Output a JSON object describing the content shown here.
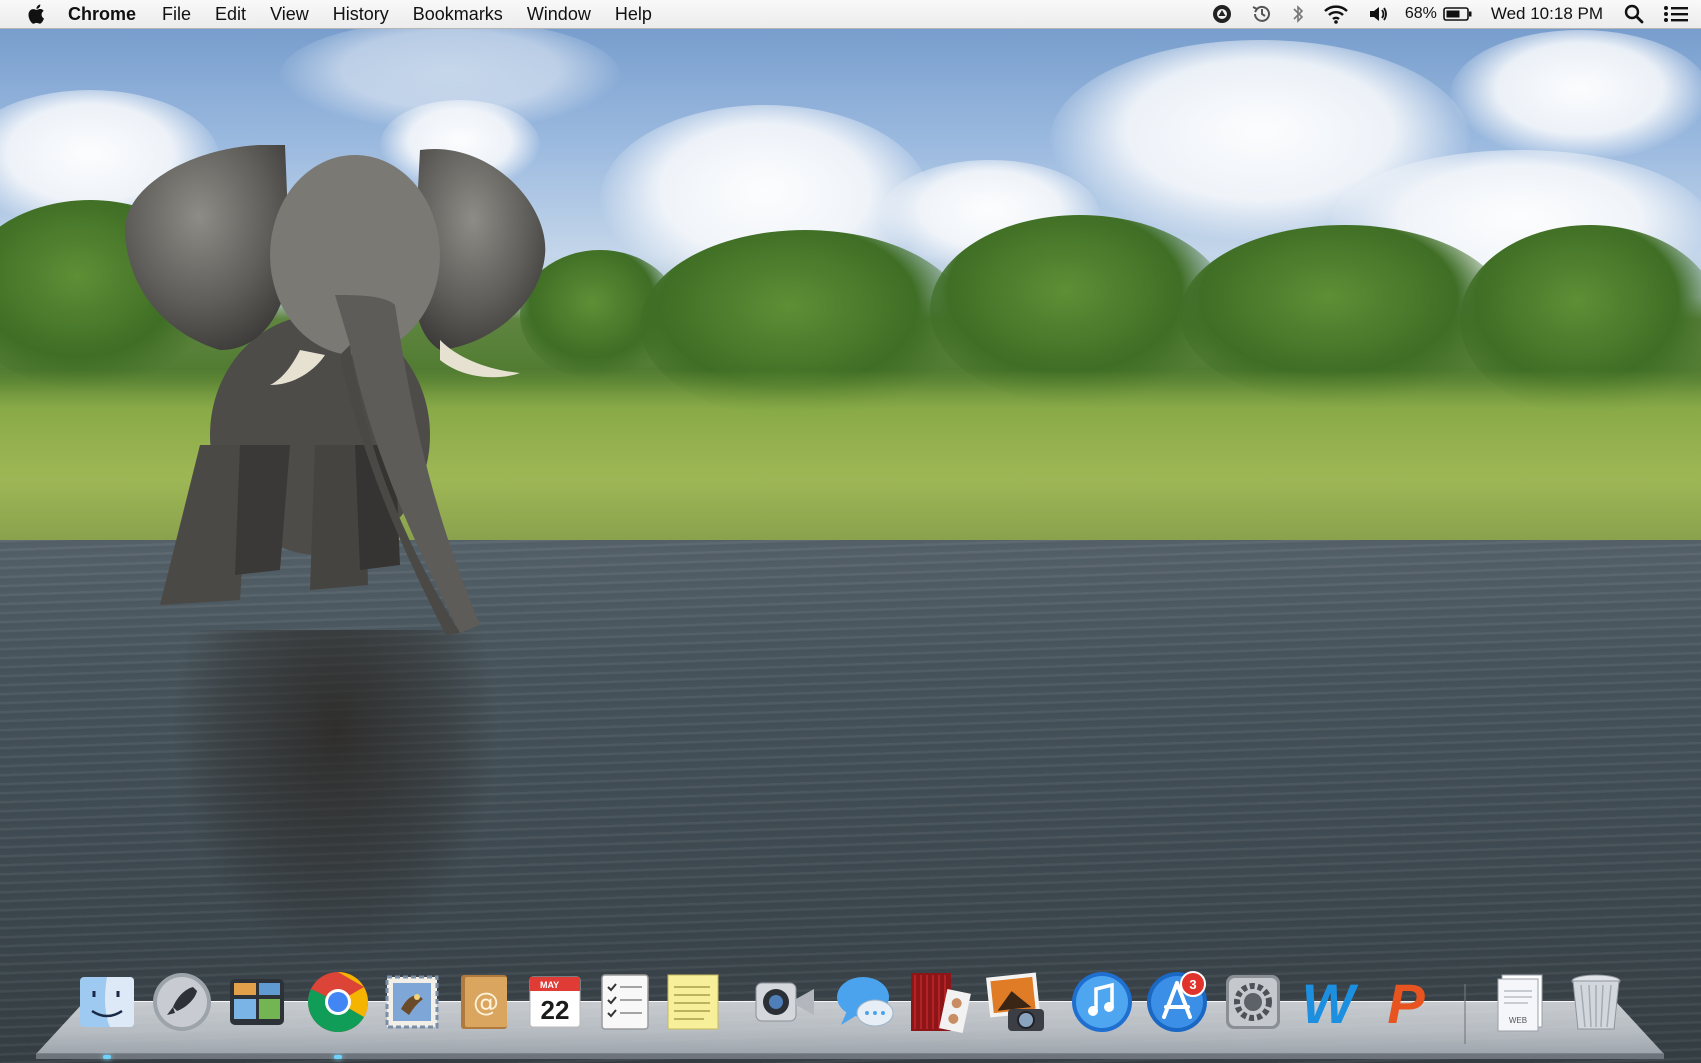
{
  "menubar": {
    "app_name": "Chrome",
    "menus": [
      "File",
      "Edit",
      "View",
      "History",
      "Bookmarks",
      "Window",
      "Help"
    ],
    "status": {
      "icons": [
        "google-drive-icon",
        "time-machine-icon",
        "bluetooth-icon",
        "wifi-icon",
        "volume-icon"
      ],
      "battery_percent": "68%",
      "clock": "Wed 10:18 PM"
    }
  },
  "desktop": {
    "wallpaper": "elephant-river"
  },
  "dock": {
    "apps": [
      {
        "name": "Finder",
        "icon": "finder-icon"
      },
      {
        "name": "Launchpad",
        "icon": "launchpad-icon"
      },
      {
        "name": "Mission Control",
        "icon": "mission-control-icon"
      },
      {
        "name": "Google Chrome",
        "icon": "chrome-icon"
      },
      {
        "name": "Mail",
        "icon": "mail-icon"
      },
      {
        "name": "Contacts",
        "icon": "contacts-icon"
      },
      {
        "name": "Calendar",
        "icon": "calendar-icon",
        "month": "MAY",
        "day": "22"
      },
      {
        "name": "Reminders",
        "icon": "reminders-icon"
      },
      {
        "name": "Notes",
        "icon": "notes-icon"
      },
      {
        "name": "FaceTime",
        "icon": "facetime-icon"
      },
      {
        "name": "Messages",
        "icon": "messages-icon"
      },
      {
        "name": "Photo Booth",
        "icon": "photo-booth-icon"
      },
      {
        "name": "iPhoto",
        "icon": "iphoto-icon"
      },
      {
        "name": "iTunes",
        "icon": "itunes-icon"
      },
      {
        "name": "App Store",
        "icon": "app-store-icon",
        "badge": "3"
      },
      {
        "name": "System Preferences",
        "icon": "system-preferences-icon"
      },
      {
        "name": "Microsoft Word",
        "icon": "word-icon",
        "letter": "W"
      },
      {
        "name": "Microsoft PowerPoint",
        "icon": "powerpoint-icon",
        "letter": "P"
      }
    ],
    "stack": {
      "name": "Documents",
      "label": "WEB"
    },
    "trash": {
      "name": "Trash"
    }
  }
}
